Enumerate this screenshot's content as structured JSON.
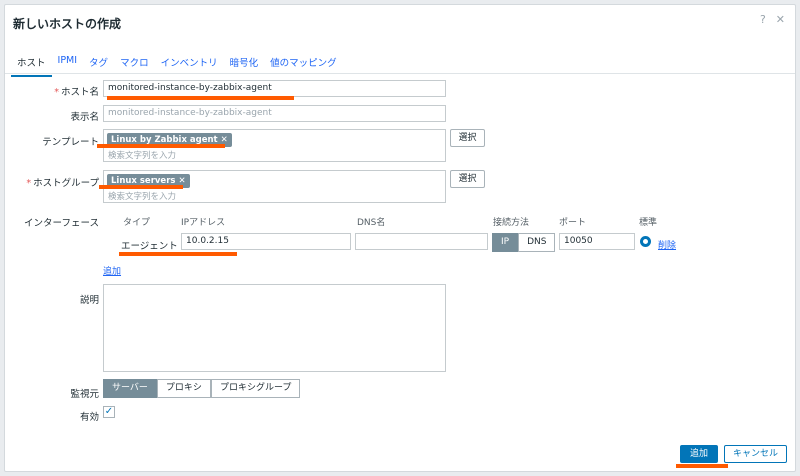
{
  "dialog": {
    "title": "新しいホストの作成",
    "help_icon": "?",
    "close_icon": "✕"
  },
  "tabs": [
    {
      "label": "ホスト",
      "active": true
    },
    {
      "label": "IPMI"
    },
    {
      "label": "タグ"
    },
    {
      "label": "マクロ"
    },
    {
      "label": "インベントリ"
    },
    {
      "label": "暗号化"
    },
    {
      "label": "値のマッピング"
    }
  ],
  "form": {
    "hostname": {
      "label": "ホスト名",
      "required_mark": "*",
      "value": "monitored-instance-by-zabbix-agent"
    },
    "visible_name": {
      "label": "表示名",
      "placeholder": "monitored-instance-by-zabbix-agent"
    },
    "templates": {
      "label": "テンプレート",
      "chip": "Linux by Zabbix agent",
      "chip_remove": "✕",
      "placeholder": "検索文字列を入力",
      "select_button": "選択"
    },
    "host_groups": {
      "label": "ホストグループ",
      "required_mark": "*",
      "chip": "Linux servers",
      "chip_remove": "✕",
      "placeholder": "検索文字列を入力",
      "select_button": "選択"
    },
    "interfaces": {
      "label": "インターフェース",
      "columns": {
        "type": "タイプ",
        "ip": "IPアドレス",
        "dns": "DNS名",
        "connect": "接続方法",
        "port": "ポート",
        "default": "標準"
      },
      "row": {
        "type": "エージェント",
        "ip": "10.0.2.15",
        "dns": "",
        "ip_toggle": "IP",
        "dns_toggle": "DNS",
        "port": "10050",
        "remove": "削除"
      },
      "add": "追加"
    },
    "description": {
      "label": "説明",
      "value": ""
    },
    "monitored_by": {
      "label": "監視元",
      "options": [
        "サーバー",
        "プロキシ",
        "プロキシグループ"
      ],
      "selected": "サーバー"
    },
    "enabled": {
      "label": "有効",
      "check": "✓",
      "checked": true
    }
  },
  "footer": {
    "add_button": "追加",
    "cancel_button": "キャンセル"
  }
}
